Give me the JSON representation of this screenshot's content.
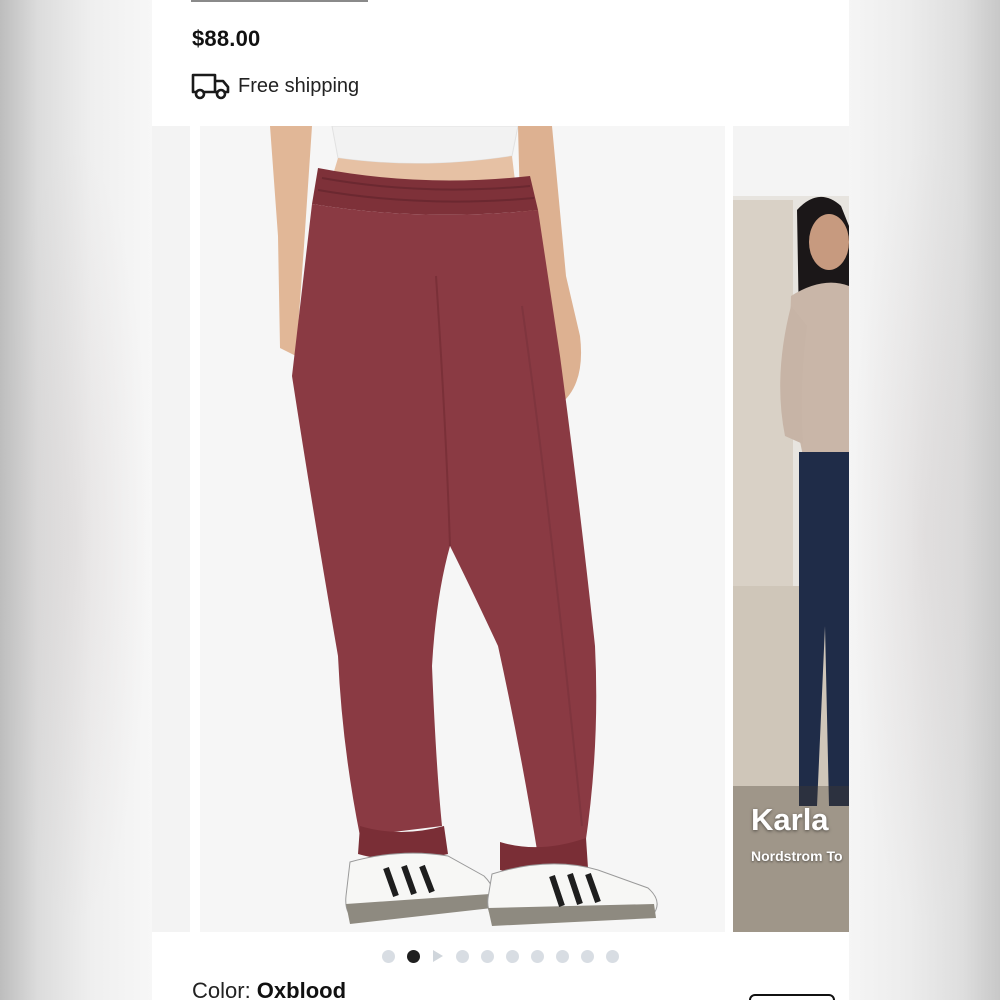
{
  "product": {
    "price": "$88.00",
    "shipping_text": "Free shipping",
    "color_label": "Color:",
    "color_value": "Oxblood"
  },
  "gallery": {
    "main_image": "Oxblood sweatpants worn with white and black sneakers, back view",
    "video_caption_name": "Karla",
    "video_caption_sub": "Nordstrom To",
    "pagination": {
      "total_dots": 10,
      "active_index": 1,
      "play_indicator_index": 2
    }
  },
  "icons": {
    "shipping": "truck-icon",
    "video": "play-icon"
  },
  "colors": {
    "pants": "#8a3a43",
    "active_dot": "#1f1f1f",
    "inactive_dot": "#d8dde3"
  }
}
